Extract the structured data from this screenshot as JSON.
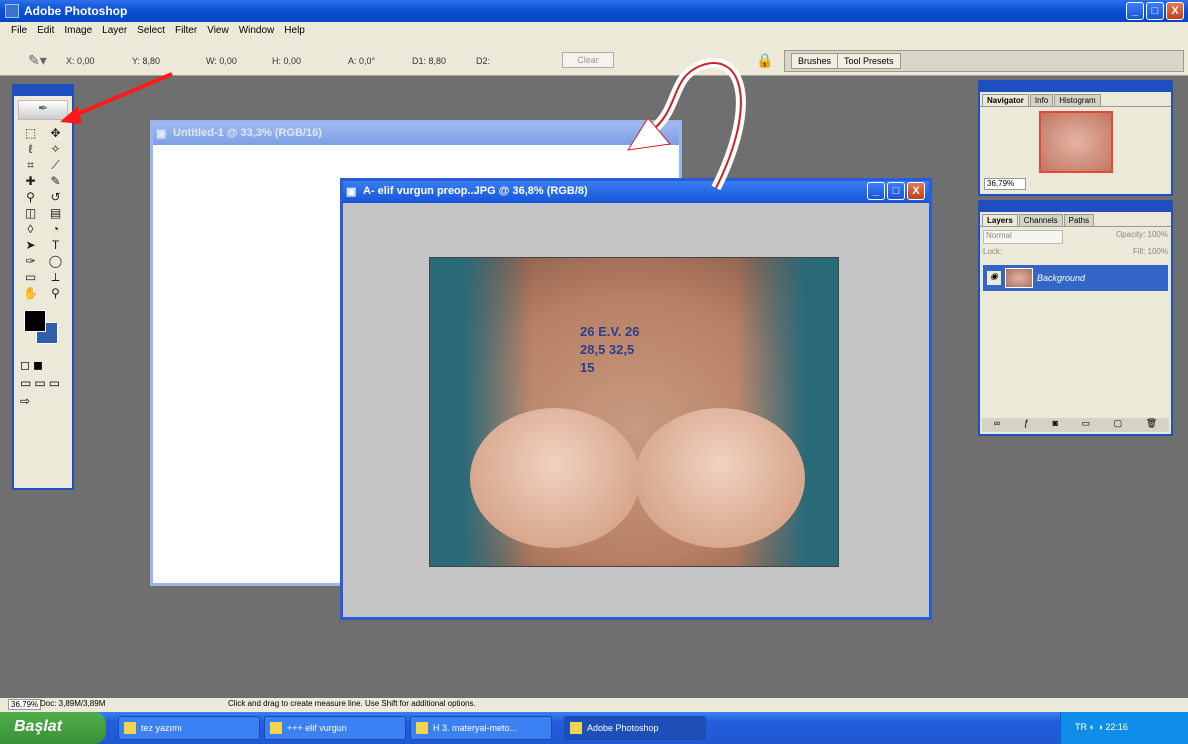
{
  "app": {
    "title": "Adobe Photoshop"
  },
  "window_buttons": {
    "minimize": "_",
    "maximize": "□",
    "close": "X"
  },
  "menu": [
    "File",
    "Edit",
    "Image",
    "Layer",
    "Select",
    "Filter",
    "View",
    "Window",
    "Help"
  ],
  "options": {
    "x": "X: 0,00",
    "y": "Y: 8,80",
    "w": "W: 0,00",
    "h": "H: 0,00",
    "a": "A: 0,0°",
    "d1": "D1: 8,80",
    "d2": "D2:",
    "clear": "Clear",
    "palette_tabs": [
      "Brushes",
      "Tool Presets"
    ]
  },
  "documents": [
    {
      "title": "Untitled-1 @ 33,3% (RGB/16)"
    },
    {
      "title": "A- elif vurgun preop..JPG @ 36,8% (RGB/8)",
      "markings": [
        "26 E.V. 26",
        "28,5 32,5",
        "15"
      ]
    }
  ],
  "navigator": {
    "tabs": [
      "Navigator",
      "Info",
      "Histogram"
    ],
    "zoom": "36,79%"
  },
  "layers": {
    "tabs": [
      "Layers",
      "Channels",
      "Paths"
    ],
    "blend_mode": "Normal",
    "opacity_label": "Opacity:",
    "opacity": "100%",
    "lock_label": "Lock:",
    "fill_label": "Fill:",
    "fill": "100%",
    "items": [
      {
        "name": "Background"
      }
    ]
  },
  "status": {
    "zoom": "36,79%",
    "doc": "Doc: 3,89M/3,89M",
    "hint": "Click and drag to create measure line. Use Shift for additional options."
  },
  "taskbar": {
    "start": "Başlat",
    "items": [
      "tez yazımı",
      "+++ elif vurgun",
      "H 3. materyal-meto...",
      "Adobe Photoshop"
    ],
    "tray_lang": "TR",
    "clock": "22:16"
  }
}
